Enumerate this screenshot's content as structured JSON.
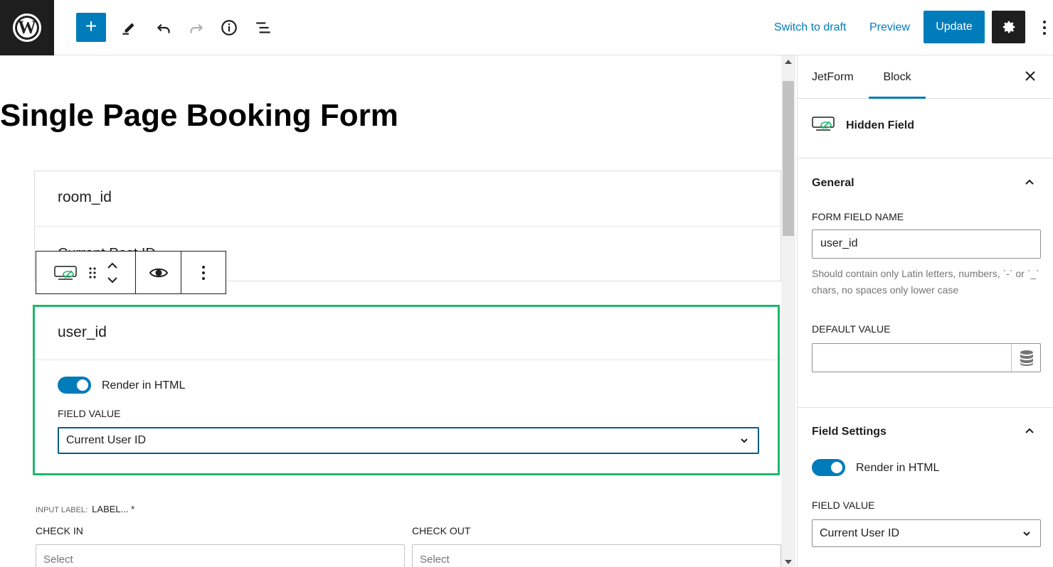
{
  "topbar": {
    "switch_to_draft": "Switch to draft",
    "preview": "Preview",
    "update": "Update",
    "add_symbol": "+"
  },
  "editor": {
    "page_title": "Single Page Booking Form",
    "room_block": {
      "field_name": "room_id",
      "partial_value": "Current Post ID"
    },
    "user_block": {
      "field_name": "user_id",
      "render_html_label": "Render in HTML",
      "render_html_on": true,
      "field_value_label": "FIELD VALUE",
      "field_value": "Current User ID"
    },
    "input_label_key": "INPUT LABEL:",
    "input_label_value": "LABEL... *",
    "check_in_label": "CHECK IN",
    "check_out_label": "CHECK OUT",
    "check_in_placeholder": "Select",
    "check_out_placeholder": "Select"
  },
  "sidebar": {
    "tabs": [
      "JetForm",
      "Block"
    ],
    "active_tab": "Block",
    "block_name": "Hidden Field",
    "general": {
      "title": "General",
      "form_field_name_label": "FORM FIELD NAME",
      "form_field_name_value": "user_id",
      "help_text": "Should contain only Latin letters, numbers, `-` or `_` chars, no spaces only lower case",
      "default_value_label": "DEFAULT VALUE",
      "default_value": ""
    },
    "field_settings": {
      "title": "Field Settings",
      "render_html_label": "Render in HTML",
      "render_html_on": true,
      "field_value_label": "FIELD VALUE",
      "field_value": "Current User ID"
    }
  },
  "colors": {
    "accent": "#007cba",
    "selected_outline": "#1fb86a",
    "dark": "#1e1e1e"
  }
}
